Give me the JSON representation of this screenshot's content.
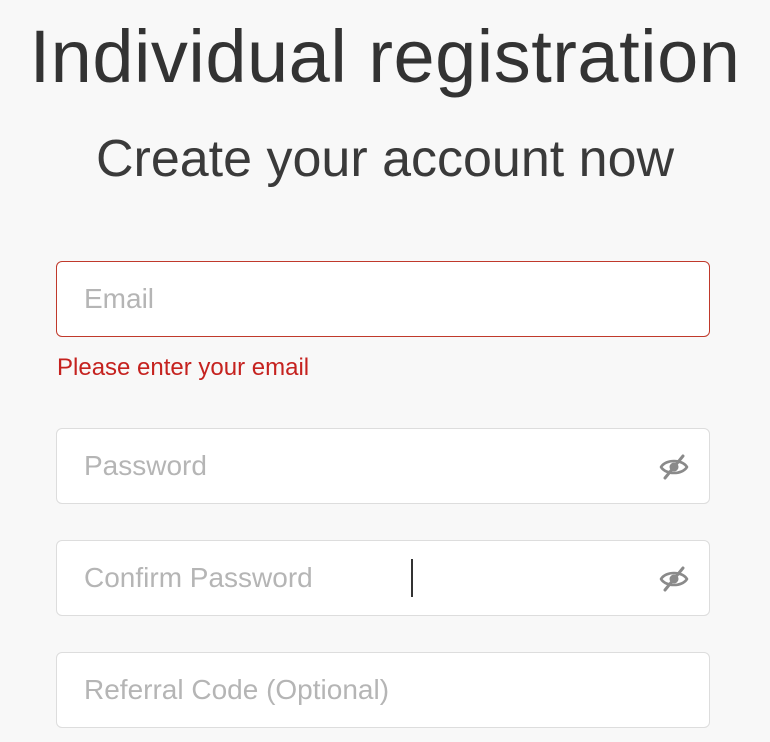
{
  "header": {
    "title": "Individual registration",
    "subtitle": "Create your account now"
  },
  "form": {
    "email": {
      "placeholder": "Email",
      "value": "",
      "error": "Please enter your email"
    },
    "password": {
      "placeholder": "Password",
      "value": "",
      "toggle_icon": "eye-slash-icon"
    },
    "confirm_password": {
      "placeholder": "Confirm Password",
      "value": "",
      "toggle_icon": "eye-slash-icon"
    },
    "referral_code": {
      "placeholder": "Referral Code (Optional)",
      "value": ""
    }
  },
  "colors": {
    "background": "#f8f8f8",
    "error": "#c5221f",
    "border": "#dddddd",
    "placeholder": "#b5b5b5"
  }
}
